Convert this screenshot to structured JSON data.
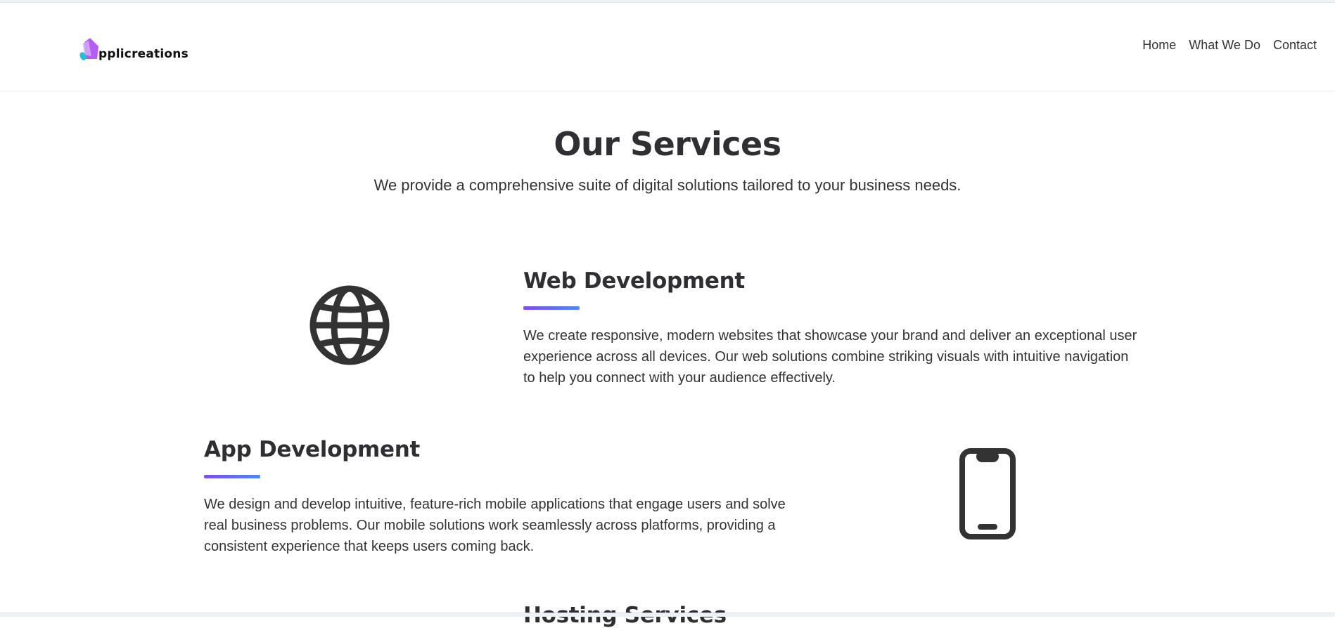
{
  "header": {
    "logo_text": "pplicreations",
    "nav": [
      "Home",
      "What We Do",
      "Contact"
    ]
  },
  "hero": {
    "title": "Our Services",
    "subtitle": "We provide a comprehensive suite of digital solutions tailored to your business needs."
  },
  "services": [
    {
      "title": "Web Development",
      "description": "We create responsive, modern websites that showcase your brand and deliver an exceptional user experience across all devices. Our web solutions combine striking visuals with intuitive navigation to help you connect with your audience effectively.",
      "icon": "globe-icon"
    },
    {
      "title": "App Development",
      "description": "We design and develop intuitive, feature-rich mobile applications that engage users and solve real business problems. Our mobile solutions work seamlessly across platforms, providing a consistent experience that keeps users coming back.",
      "icon": "phone-icon"
    },
    {
      "title": "Hosting Services",
      "description": "",
      "icon": ""
    }
  ],
  "colors": {
    "accent_start": "#7b4ff0",
    "accent_end": "#4f86f6",
    "text": "#2f2f33",
    "logo_purple": "#9b59f0",
    "logo_teal": "#24c1d6"
  }
}
